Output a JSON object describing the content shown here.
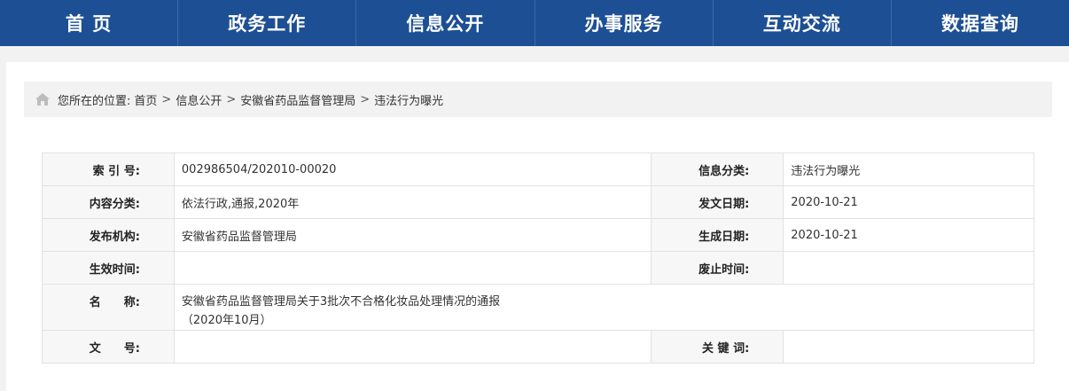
{
  "nav": {
    "items": [
      {
        "label": "首 页"
      },
      {
        "label": "政务工作"
      },
      {
        "label": "信息公开"
      },
      {
        "label": "办事服务"
      },
      {
        "label": "互动交流"
      },
      {
        "label": "数据查询"
      }
    ]
  },
  "breadcrumb": {
    "prefix": "您所在的位置:",
    "items": [
      "首页",
      "信息公开",
      "安徽省药品监督管理局",
      "违法行为曝光"
    ],
    "separator": ">"
  },
  "meta": {
    "index_no": {
      "label": "索 引 号:",
      "value": "002986504/202010-00020"
    },
    "info_category": {
      "label": "信息分类:",
      "value": "违法行为曝光"
    },
    "content_category": {
      "label": "内容分类:",
      "value": "依法行政,通报,2020年"
    },
    "issue_date": {
      "label": "发文日期:",
      "value": "2020-10-21"
    },
    "publisher": {
      "label": "发布机构:",
      "value": "安徽省药品监督管理局"
    },
    "generate_date": {
      "label": "生成日期:",
      "value": "2020-10-21"
    },
    "effective_time": {
      "label": "生效时间:",
      "value": ""
    },
    "expiry_time": {
      "label": "废止时间:",
      "value": ""
    },
    "title": {
      "label": "名　　称:",
      "line1": "安徽省药品监督管理局关于3批次不合格化妆品处理情况的通报",
      "line2": "（2020年10月）"
    },
    "doc_no": {
      "label": "文　　号:",
      "value": ""
    },
    "keywords": {
      "label": "关 键 词:",
      "value": ""
    }
  },
  "colors": {
    "nav_bg": "#1d4f94",
    "page_bg": "#f2f2f2",
    "label_bg": "#f7f7f7"
  }
}
